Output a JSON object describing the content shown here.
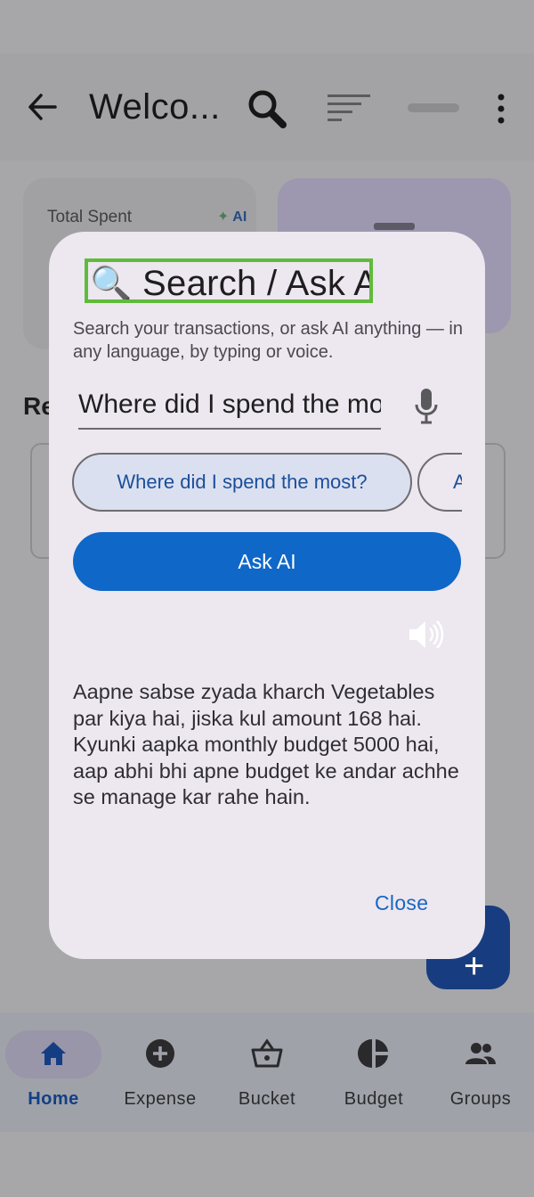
{
  "app_bar": {
    "title": "Welco...",
    "icons": [
      "back-arrow-icon",
      "search-icon",
      "sort-icon",
      "minus-icon",
      "more-vert-icon"
    ]
  },
  "summary_card": {
    "label": "Total Spent",
    "ai_badge": "AI"
  },
  "section": {
    "title_stub": "Re"
  },
  "dialog": {
    "title_icon": "🔍",
    "title": "Search / Ask A",
    "subtitle": "Search your transactions, or ask AI anything — in any language, by typing or voice.",
    "input_value": "Where did I spend the mo",
    "suggestions": [
      "Where did I spend the most?",
      "A"
    ],
    "ask_button": "Ask AI",
    "answer": "Aapne sabse zyada kharch Vegetables par kiya hai, jiska kul amount 168 hai. Kyunki aapka monthly budget 5000 hai, aap abhi bhi apne budget ke andar achhe se manage kar rahe hain.",
    "close_button": "Close",
    "accent_color": "#0f67c8",
    "highlight_color": "#5fbb3a"
  },
  "bottom_nav": {
    "items": [
      {
        "label": "Home",
        "icon": "home-icon",
        "active": true
      },
      {
        "label": "Expense",
        "icon": "add-circle-icon",
        "active": false
      },
      {
        "label": "Bucket",
        "icon": "basket-icon",
        "active": false
      },
      {
        "label": "Budget",
        "icon": "pie-chart-icon",
        "active": false
      },
      {
        "label": "Groups",
        "icon": "groups-icon",
        "active": false
      }
    ]
  }
}
